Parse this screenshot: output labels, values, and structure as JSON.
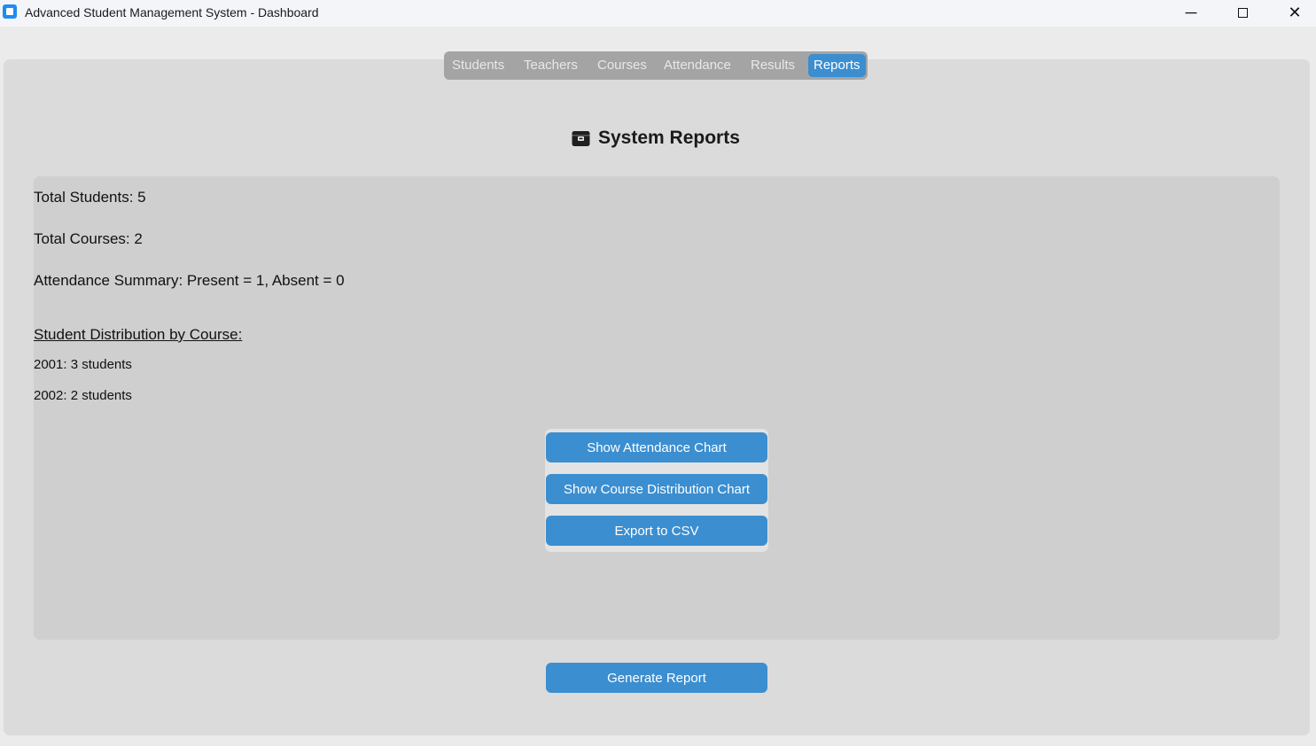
{
  "window": {
    "title": "Advanced Student Management System - Dashboard",
    "minimize_glyph": "─",
    "close_glyph": "✕"
  },
  "tabs": [
    {
      "label": "Students",
      "active": false
    },
    {
      "label": "Teachers",
      "active": false
    },
    {
      "label": "Courses",
      "active": false
    },
    {
      "label": "Attendance",
      "active": false
    },
    {
      "label": "Results",
      "active": false
    },
    {
      "label": "Reports",
      "active": true
    }
  ],
  "reports": {
    "icon": "card-index-box-icon",
    "title": "System Reports",
    "total_students": "Total Students: 5",
    "total_courses": "Total Courses: 2",
    "attendance_summary": "Attendance Summary: Present = 1, Absent = 0",
    "distribution_heading": "Student Distribution by Course:",
    "distribution": [
      "2001: 3 students",
      "2002: 2 students"
    ]
  },
  "buttons": {
    "attendance_chart": "Show Attendance Chart",
    "course_chart": "Show Course Distribution Chart",
    "export_csv": "Export to CSV",
    "generate_report": "Generate Report"
  },
  "colors": {
    "accent": "#3b8ed0",
    "tabbar_bg": "#a4a4a4",
    "panel_bg": "#dbdbdb",
    "report_bg": "#cfcfcf"
  }
}
